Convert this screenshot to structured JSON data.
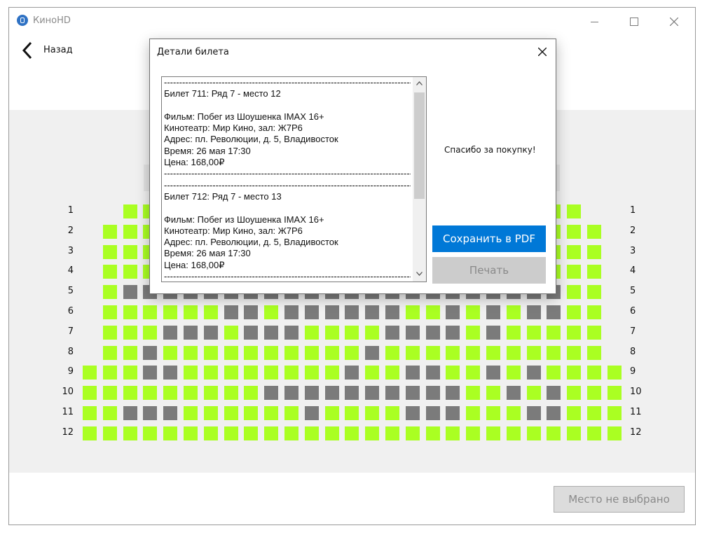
{
  "app": {
    "title": "КиноHD"
  },
  "nav": {
    "back_label": "Назад"
  },
  "dialog": {
    "title": "Детали билета",
    "ticket_text": "------------------------------------------------------------------------------------------------------\nБилет 711: Ряд 7 - место 12\n\nФильм: Побег из Шоушенка IMAX 16+\nКинотеатр: Мир Кино, зал: Ж7Р6\nАдрес: пл. Революции, д. 5, Владивосток\nВремя: 26 мая 17:30\nЦена: 168,00₽\n------------------------------------------------------------------------------------------------------\n------------------------------------------------------------------------------------------------------\nБилет 712: Ряд 7 - место 13\n\nФильм: Побег из Шоушенка IMAX 16+\nКинотеатр: Мир Кино, зал: Ж7Р6\nАдрес: пл. Революции, д. 5, Владивосток\nВремя: 26 мая 17:30\nЦена: 168,00₽\n------------------------------------------------------------------------------------------------------",
    "thanks": "Спасибо за покупку!",
    "save_pdf": "Сохранить в PDF",
    "print": "Печать"
  },
  "bottom": {
    "status_button": "Место не выбрано"
  },
  "colors": {
    "free": "#aaff22",
    "taken": "#7b7b7b",
    "accent": "#0078d7"
  },
  "hall": {
    "rows": [
      {
        "label": "1",
        "start": 2,
        "map": "FFFFFFFFFFFFFFFFFFFFFFF"
      },
      {
        "label": "2",
        "start": 1,
        "map": "FFFFFFFFFFFFFFFFFFFFFFFFF"
      },
      {
        "label": "3",
        "start": 1,
        "map": "FFFFFFFFFFFFFFFFFFFFFFFFF"
      },
      {
        "label": "4",
        "start": 1,
        "map": "FFFFFFFFFFFFFFFFFFFFFFFFF"
      },
      {
        "label": "5",
        "start": 1,
        "map": "FTTTTTTTTTTTTTTTTTTTTTTFF"
      },
      {
        "label": "6",
        "start": 1,
        "map": "FFFFFFTTFTTTTTTFFTFTFTTFF"
      },
      {
        "label": "7",
        "start": 1,
        "map": "FFFTTTFTTTFFFFTTTTFTFFFFF"
      },
      {
        "label": "8",
        "start": 1,
        "map": "FFTFFFFFFFFFFTFFFFFFFFFFF"
      },
      {
        "label": "9",
        "start": 0,
        "map": "FFFTTFFFFFFFFTFFTTFFTFTFFFF"
      },
      {
        "label": "10",
        "start": 0,
        "map": "FFFFFFFFFTTTTTTTTTTFFTFTFFF"
      },
      {
        "label": "11",
        "start": 0,
        "map": "FFTTTFFFFFFTFFFFTTTFFFTTFFF"
      },
      {
        "label": "12",
        "start": 0,
        "map": "FFFFFFFFFFFFFFFFFFFFFFFFFFF"
      }
    ]
  }
}
